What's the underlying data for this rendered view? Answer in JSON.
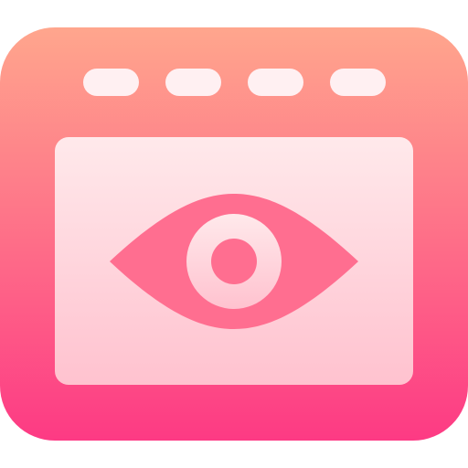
{
  "icon": {
    "name": "browser-window-eye-icon",
    "gradient_top": "#FFA68D",
    "gradient_bottom": "#FD3A84",
    "panel_top": "#FFE9EB",
    "panel_bottom": "#FFC2CF",
    "tab_color": "#FFF0F2",
    "eye_color": "#FF6E90",
    "tab_count": 4
  }
}
